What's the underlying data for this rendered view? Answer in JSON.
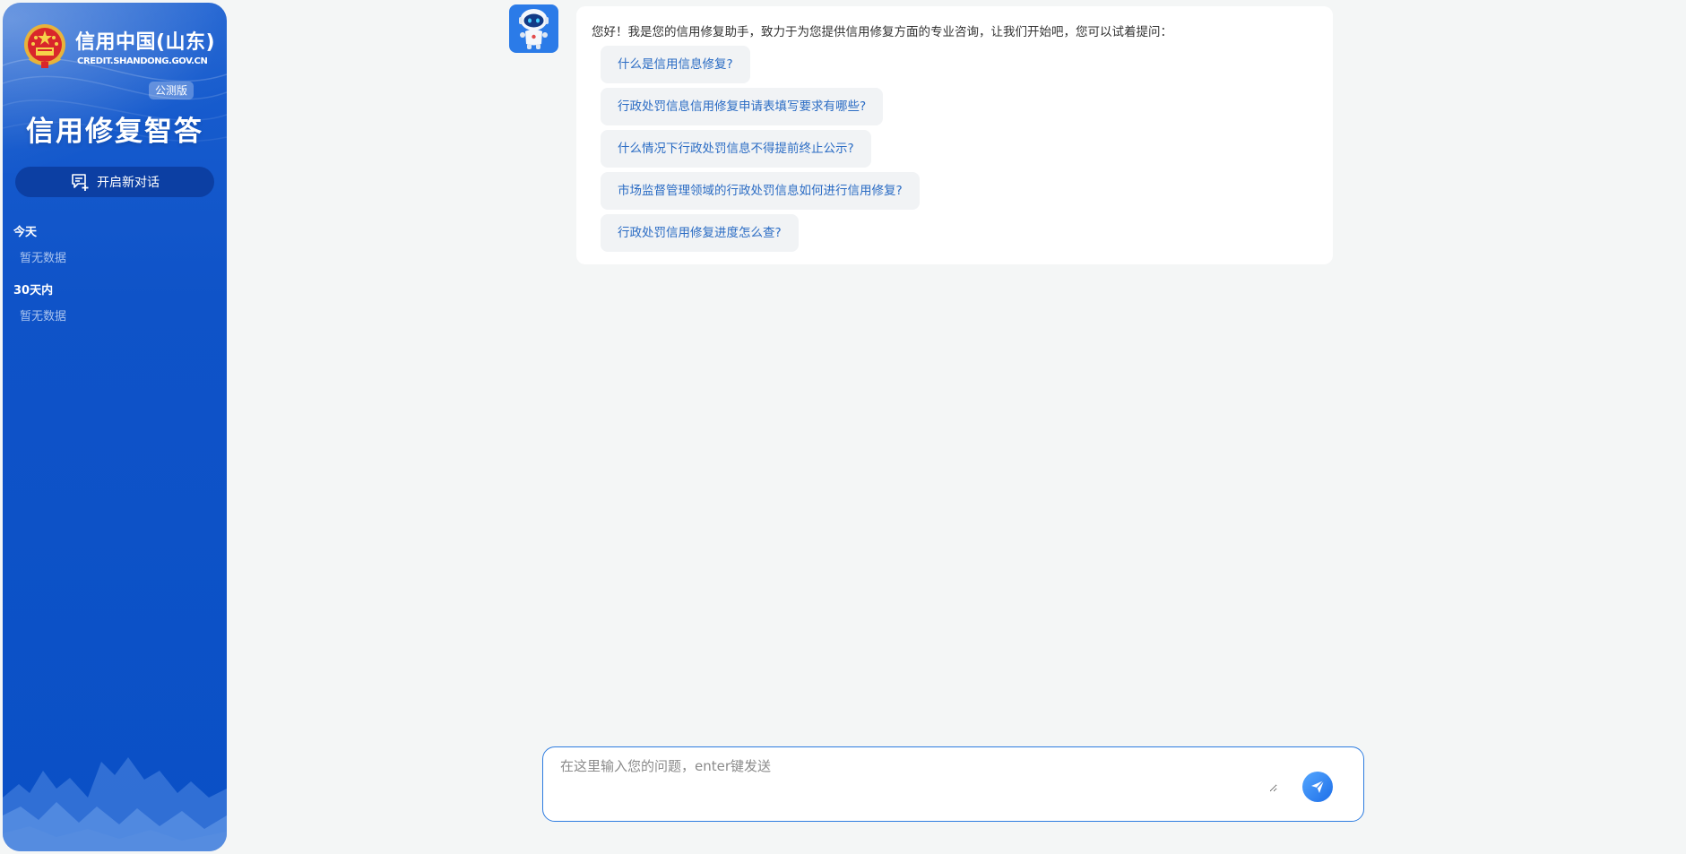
{
  "sidebar": {
    "brand_title": "信用中国(山东)",
    "brand_url": "CREDIT.SHANDONG.GOV.CN",
    "beta_badge": "公测版",
    "app_title": "信用修复智答",
    "new_chat_label": "开启新对话",
    "history": [
      {
        "heading": "今天",
        "empty_text": "暂无数据"
      },
      {
        "heading": "30天内",
        "empty_text": "暂无数据"
      }
    ]
  },
  "chat": {
    "greeting": "您好！我是您的信用修复助手，致力于为您提供信用修复方面的专业咨询，让我们开始吧，您可以试着提问：",
    "suggestions": [
      "什么是信用信息修复?",
      "行政处罚信息信用修复申请表填写要求有哪些?",
      "什么情况下行政处罚信息不得提前终止公示?",
      "市场监督管理领域的行政处罚信息如何进行信用修复?",
      "行政处罚信用修复进度怎么查?"
    ]
  },
  "input": {
    "placeholder": "在这里输入您的问题，enter键发送",
    "value": ""
  },
  "icons": {
    "emblem": "national-emblem-icon",
    "new_chat": "new-chat-icon",
    "avatar": "robot-avatar-icon",
    "send": "send-icon"
  },
  "colors": {
    "sidebar_bg": "#0f53c8",
    "new_chat_button_bg": "#0c3fa3",
    "suggestion_text": "#2b6cc4",
    "suggestion_bg": "#f1f3f5",
    "input_border": "#2d7ce0",
    "page_bg": "#f4f6f6"
  }
}
